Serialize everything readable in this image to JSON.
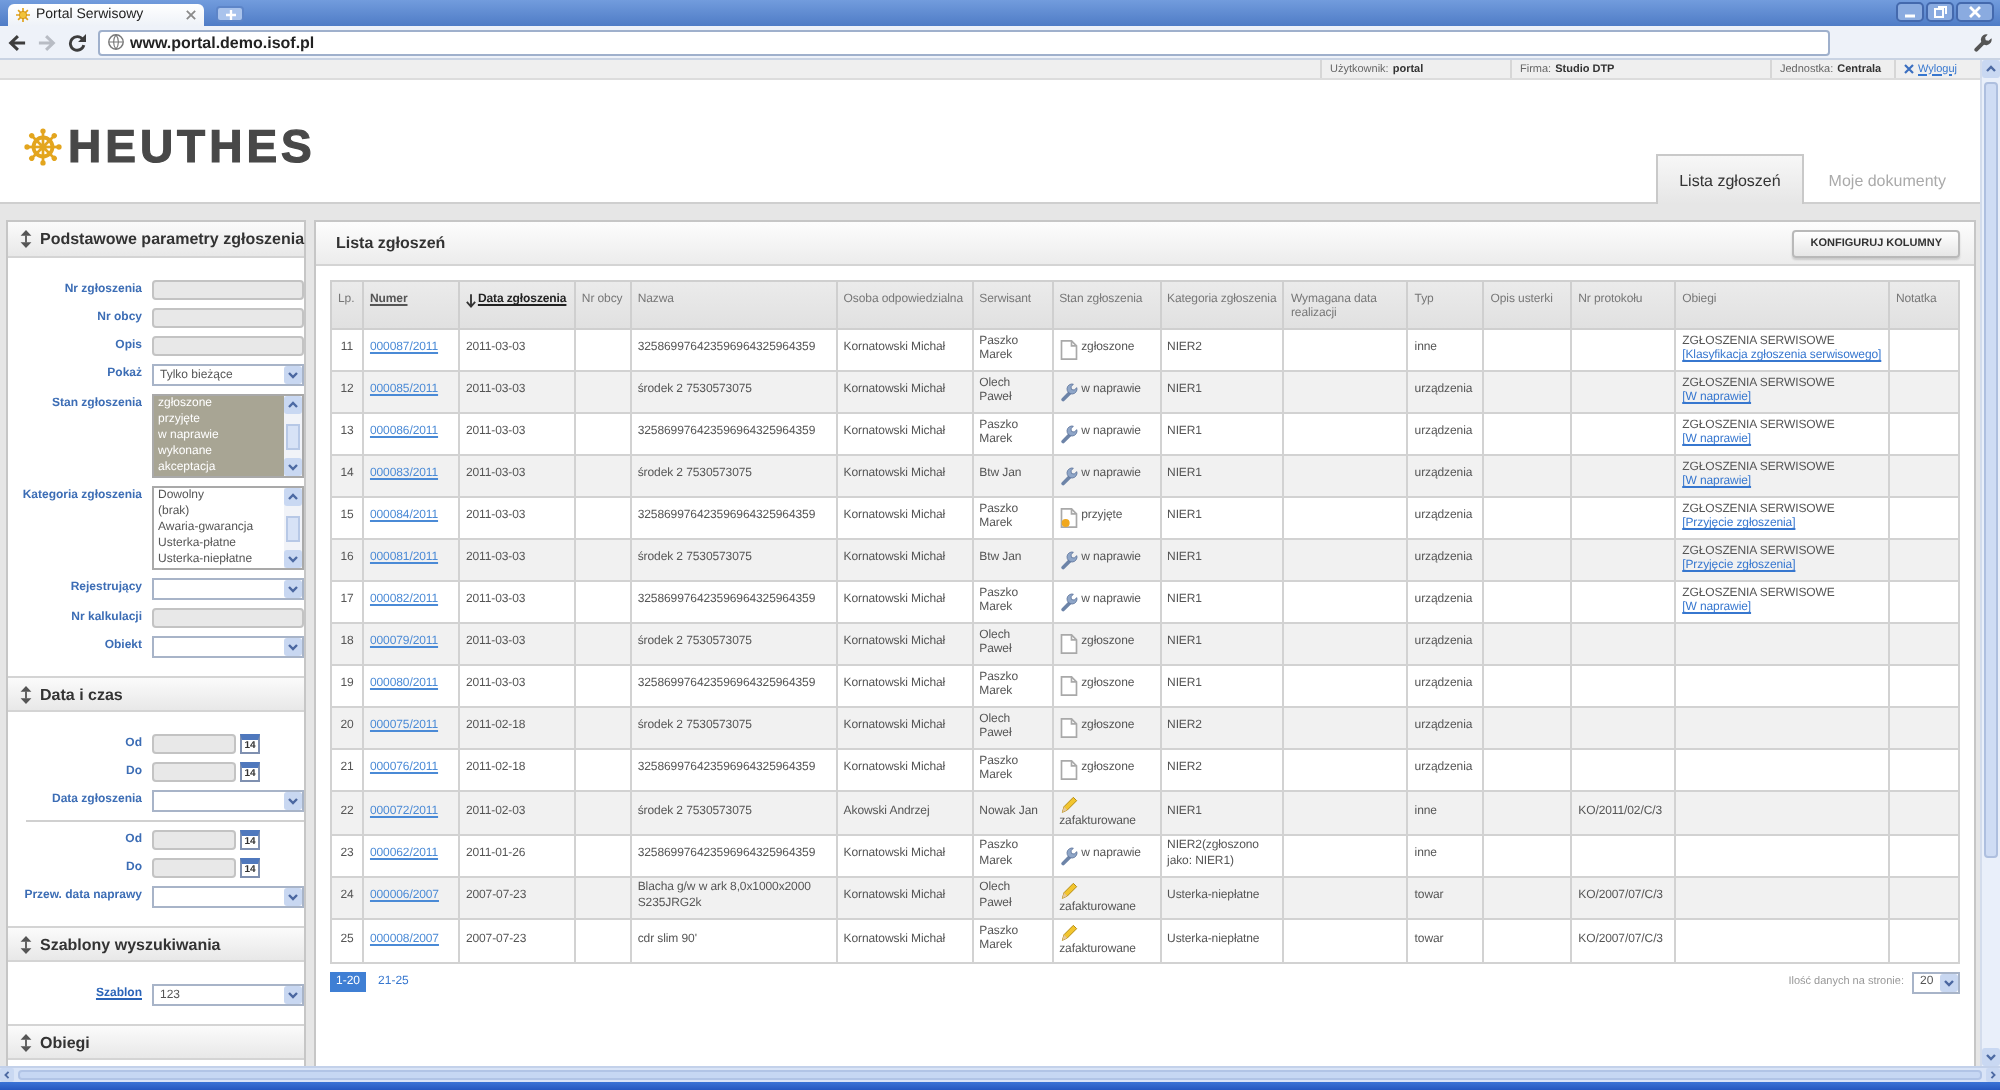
{
  "browser": {
    "tab_title": "Portal Serwisowy",
    "nav": [
      {
        "kind": "back",
        "disabled": false
      },
      {
        "kind": "forward",
        "disabled": true
      },
      {
        "kind": "reload",
        "disabled": false
      }
    ],
    "address": "www.portal.demo.isof.pl"
  },
  "user_bar": {
    "items": [
      "Użytkownik: **portal**",
      "Firma: **Studio DTP**",
      "Jednostka: **Centrala**"
    ],
    "logout": "Wyloguj"
  },
  "logo": "HEUTHES",
  "tabs": [
    {
      "label": "Lista zgłoszeń",
      "selected": true
    },
    {
      "label": "Moje dokumenty",
      "selected": false
    }
  ],
  "sidebar": {
    "sections": [
      {
        "title": "Podstawowe parametry zgłoszenia",
        "fields": [
          {
            "kind": "input",
            "label": "Nr zgłoszenia",
            "link": false
          },
          {
            "kind": "input",
            "label": "Nr obcy",
            "link": false
          },
          {
            "kind": "input",
            "label": "Opis",
            "link": false
          },
          {
            "kind": "select",
            "label": "Pokaż",
            "link": false,
            "value": "Tylko bieżące"
          },
          {
            "kind": "listbox",
            "label": "Stan zgłoszenia",
            "link": false,
            "options": [
              {
                "text": "zgłoszone",
                "selected": true
              },
              {
                "text": "przyjęte",
                "selected": true
              },
              {
                "text": "w naprawie",
                "selected": true
              },
              {
                "text": "wykonane",
                "selected": true
              },
              {
                "text": "akceptacja",
                "selected": true
              }
            ]
          },
          {
            "kind": "listbox",
            "label": "Kategoria zgłoszenia",
            "link": false,
            "options": [
              {
                "text": "Dowolny",
                "selected": false
              },
              {
                "text": "(brak)",
                "selected": false
              },
              {
                "text": "Awaria-gwarancja",
                "selected": false
              },
              {
                "text": "Usterka-płatne",
                "selected": false
              },
              {
                "text": "Usterka-niepłatne",
                "selected": false
              }
            ]
          },
          {
            "kind": "select",
            "label": "Rejestrujący",
            "link": false
          },
          {
            "kind": "input",
            "label": "Nr kalkulacji",
            "link": false
          },
          {
            "kind": "select",
            "label": "Obiekt",
            "link": false
          }
        ]
      },
      {
        "title": "Data i czas",
        "fields": [
          {
            "kind": "date",
            "label": "Od",
            "link": false,
            "calendar": "14"
          },
          {
            "kind": "date",
            "label": "Do",
            "link": false,
            "calendar": "14"
          },
          {
            "kind": "select",
            "label": "Data zgłoszenia",
            "link": false
          },
          {
            "kind": "divider"
          },
          {
            "kind": "date",
            "label": "Od",
            "link": false,
            "calendar": "14"
          },
          {
            "kind": "date",
            "label": "Do",
            "link": false,
            "calendar": "14"
          },
          {
            "kind": "select",
            "label": "Przew. data naprawy",
            "link": false
          }
        ]
      },
      {
        "title": "Szablony wyszukiwania",
        "fields": [
          {
            "kind": "select",
            "label": "Szablon",
            "link": true,
            "value": "123"
          }
        ]
      },
      {
        "title": "Obiegi"
      }
    ]
  },
  "list_panel": {
    "title": "Lista zgłoszeń",
    "button": "KONFIGURUJ KOLUMNY",
    "table": {
      "columns": [
        {
          "label": "Lp.",
          "sortable": false,
          "sorted": false
        },
        {
          "label": "Numer",
          "sortable": true,
          "sorted": false
        },
        {
          "label": "Data zgłoszenia",
          "sortable": true,
          "sorted": true
        },
        {
          "label": "Nr obcy",
          "sortable": false,
          "sorted": false
        },
        {
          "label": "Nazwa",
          "sortable": false,
          "sorted": false
        },
        {
          "label": "Osoba odpowiedzialna",
          "sortable": false,
          "sorted": false
        },
        {
          "label": "Serwisant",
          "sortable": false,
          "sorted": false
        },
        {
          "label": "Stan zgłoszenia",
          "sortable": false,
          "sorted": false
        },
        {
          "label": "Kategoria zgłoszenia",
          "sortable": false,
          "sorted": false
        },
        {
          "label": "Wymagana data realizacji",
          "sortable": false,
          "sorted": false
        },
        {
          "label": "Typ",
          "sortable": false,
          "sorted": false
        },
        {
          "label": "Opis usterki",
          "sortable": false,
          "sorted": false
        },
        {
          "label": "Nr protokołu",
          "sortable": false,
          "sorted": false
        },
        {
          "label": "Obiegi",
          "sortable": false,
          "sorted": false
        },
        {
          "label": "Notatka",
          "sortable": false,
          "sorted": false
        }
      ],
      "rows": [
        {
          "lp": "11",
          "number": "000087/2011",
          "date": "2011-03-03",
          "name": "325869976423596964325964359",
          "person": "Kornatowski Michał",
          "technician": "Paszko Marek",
          "status": {
            "kind": "new",
            "text": "zgłoszone"
          },
          "category": "NIER2",
          "type": "inne",
          "workflow": {
            "text": "ZGŁOSZENIA SERWISOWE",
            "link": "[Klasyfikacja zgłoszenia serwisowego]"
          }
        },
        {
          "lp": "12",
          "number": "000085/2011",
          "date": "2011-03-03",
          "name": "środek 2 7530573075",
          "person": "Kornatowski Michał",
          "technician": "Olech Paweł",
          "status": {
            "kind": "repair",
            "text": "w naprawie"
          },
          "category": "NIER1",
          "type": "urządzenia",
          "workflow": {
            "text": "ZGŁOSZENIA SERWISOWE",
            "link": "[W naprawie]"
          }
        },
        {
          "lp": "13",
          "number": "000086/2011",
          "date": "2011-03-03",
          "name": "325869976423596964325964359",
          "person": "Kornatowski Michał",
          "technician": "Paszko Marek",
          "status": {
            "kind": "repair",
            "text": "w naprawie"
          },
          "category": "NIER1",
          "type": "urządzenia",
          "workflow": {
            "text": "ZGŁOSZENIA SERWISOWE",
            "link": "[W naprawie]"
          }
        },
        {
          "lp": "14",
          "number": "000083/2011",
          "date": "2011-03-03",
          "name": "środek 2 7530573075",
          "person": "Kornatowski Michał",
          "technician": "Btw Jan",
          "status": {
            "kind": "repair",
            "text": "w naprawie"
          },
          "category": "NIER1",
          "type": "urządzenia",
          "workflow": {
            "text": "ZGŁOSZENIA SERWISOWE",
            "link": "[W naprawie]"
          }
        },
        {
          "lp": "15",
          "number": "000084/2011",
          "date": "2011-03-03",
          "name": "325869976423596964325964359",
          "person": "Kornatowski Michał",
          "technician": "Paszko Marek",
          "status": {
            "kind": "accepted",
            "text": "przyjęte"
          },
          "category": "NIER1",
          "type": "urządzenia",
          "workflow": {
            "text": "ZGŁOSZENIA SERWISOWE",
            "link": "[Przyjęcie zgłoszenia]"
          }
        },
        {
          "lp": "16",
          "number": "000081/2011",
          "date": "2011-03-03",
          "name": "środek 2 7530573075",
          "person": "Kornatowski Michał",
          "technician": "Btw Jan",
          "status": {
            "kind": "repair",
            "text": "w naprawie"
          },
          "category": "NIER1",
          "type": "urządzenia",
          "workflow": {
            "text": "ZGŁOSZENIA SERWISOWE",
            "link": "[Przyjęcie zgłoszenia]"
          }
        },
        {
          "lp": "17",
          "number": "000082/2011",
          "date": "2011-03-03",
          "name": "325869976423596964325964359",
          "person": "Kornatowski Michał",
          "technician": "Paszko Marek",
          "status": {
            "kind": "repair",
            "text": "w naprawie"
          },
          "category": "NIER1",
          "type": "urządzenia",
          "workflow": {
            "text": "ZGŁOSZENIA SERWISOWE",
            "link": "[W naprawie]"
          }
        },
        {
          "lp": "18",
          "number": "000079/2011",
          "date": "2011-03-03",
          "name": "środek 2 7530573075",
          "person": "Kornatowski Michał",
          "technician": "Olech Paweł",
          "status": {
            "kind": "new",
            "text": "zgłoszone"
          },
          "category": "NIER1",
          "type": "urządzenia"
        },
        {
          "lp": "19",
          "number": "000080/2011",
          "date": "2011-03-03",
          "name": "325869976423596964325964359",
          "person": "Kornatowski Michał",
          "technician": "Paszko Marek",
          "status": {
            "kind": "new",
            "text": "zgłoszone"
          },
          "category": "NIER1",
          "type": "urządzenia"
        },
        {
          "lp": "20",
          "number": "000075/2011",
          "date": "2011-02-18",
          "name": "środek 2 7530573075",
          "person": "Kornatowski Michał",
          "technician": "Olech Paweł",
          "status": {
            "kind": "new",
            "text": "zgłoszone"
          },
          "category": "NIER2",
          "type": "urządzenia"
        },
        {
          "lp": "21",
          "number": "000076/2011",
          "date": "2011-02-18",
          "name": "325869976423596964325964359",
          "person": "Kornatowski Michał",
          "technician": "Paszko Marek",
          "status": {
            "kind": "new",
            "text": "zgłoszone"
          },
          "category": "NIER2",
          "type": "urządzenia"
        },
        {
          "lp": "22",
          "number": "000072/2011",
          "date": "2011-02-03",
          "name": "środek 2 7530573075",
          "person": "Akowski Andrzej",
          "technician": "Nowak Jan",
          "status": {
            "kind": "invoiced",
            "text": "zafakturowane"
          },
          "category": "NIER1",
          "type": "inne",
          "protocol": "KO/2011/02/C/3"
        },
        {
          "lp": "23",
          "number": "000062/2011",
          "date": "2011-01-26",
          "name": "325869976423596964325964359",
          "person": "Kornatowski Michał",
          "technician": "Paszko Marek",
          "status": {
            "kind": "repair",
            "text": "w naprawie"
          },
          "category": "NIER2(zgłoszono jako: NIER1)",
          "type": "inne"
        },
        {
          "lp": "24",
          "number": "000006/2007",
          "date": "2007-07-23",
          "name": "Blacha g/w w ark 8,0x1000x2000 S235JRG2k",
          "person": "Kornatowski Michał",
          "technician": "Olech Paweł",
          "status": {
            "kind": "invoiced",
            "text": "zafakturowane"
          },
          "category": "Usterka-niepłatne",
          "type": "towar",
          "protocol": "KO/2007/07/C/3"
        },
        {
          "lp": "25",
          "number": "000008/2007",
          "date": "2007-07-23",
          "name": "cdr slim 90'",
          "person": "Kornatowski Michał",
          "technician": "Paszko Marek",
          "status": {
            "kind": "invoiced",
            "text": "zafakturowane"
          },
          "category": "Usterka-niepłatne",
          "type": "towar",
          "protocol": "KO/2007/07/C/3"
        }
      ]
    },
    "pagination": {
      "pages": [
        {
          "label": "1-20",
          "selected": true
        },
        {
          "label": "21-25",
          "selected": false
        }
      ],
      "page_size_label": "Ilość danych na stronie:",
      "page_size": "20"
    }
  }
}
